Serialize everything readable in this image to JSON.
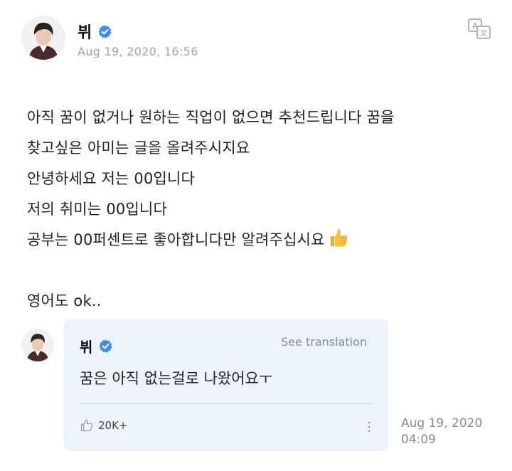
{
  "post": {
    "author": "뷔",
    "date": "Aug 19, 2020, 16:56",
    "lines": [
      "아직 꿈이 없거나 원하는 직업이 없으면 추천드립니다 꿈을",
      "찾고싶은 아미는 글을 올려주시지요",
      "안녕하세요 저는 00입니다",
      "저의 취미는 00입니다",
      "공부는 00퍼센트로 좋아합니다만 알려주십시요",
      "영어도 ok.."
    ],
    "icons": {
      "verified": "verified-badge-icon",
      "translate": "translate-icon",
      "emoji": "thumbs-up-emoji"
    }
  },
  "reply": {
    "author": "뷔",
    "see_translation": "See translation",
    "text": "꿈은 아직 없는걸로 나왔어요ㅜ",
    "likes": "20K+",
    "date_line1": "Aug 19, 2020",
    "date_line2": "04:09",
    "icons": {
      "like": "thumb-up-outline-icon",
      "more": "more-vertical-icon"
    }
  },
  "colors": {
    "verified": "#3d8cf0",
    "card_bg": "#ecf3fb",
    "muted": "#a3a3a3",
    "emoji": "#f6c43c"
  }
}
